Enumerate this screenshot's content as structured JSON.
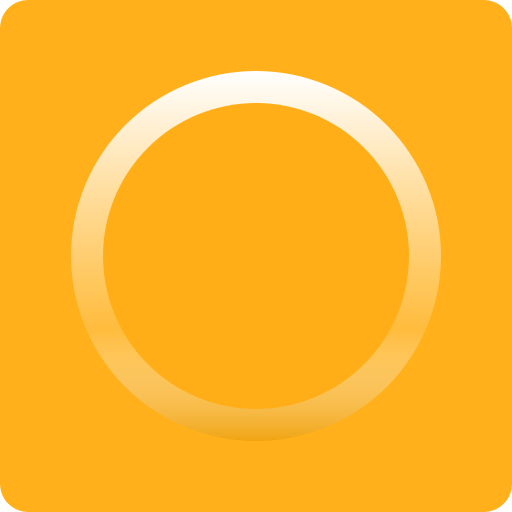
{
  "app_icon": {
    "background_color": "#FFB01A",
    "ring_highlight_color": "#FFFFFF",
    "ring_shadow_color": "#F0A412",
    "inner_fill_color": "#FFAE17",
    "icon": "ring-icon"
  }
}
